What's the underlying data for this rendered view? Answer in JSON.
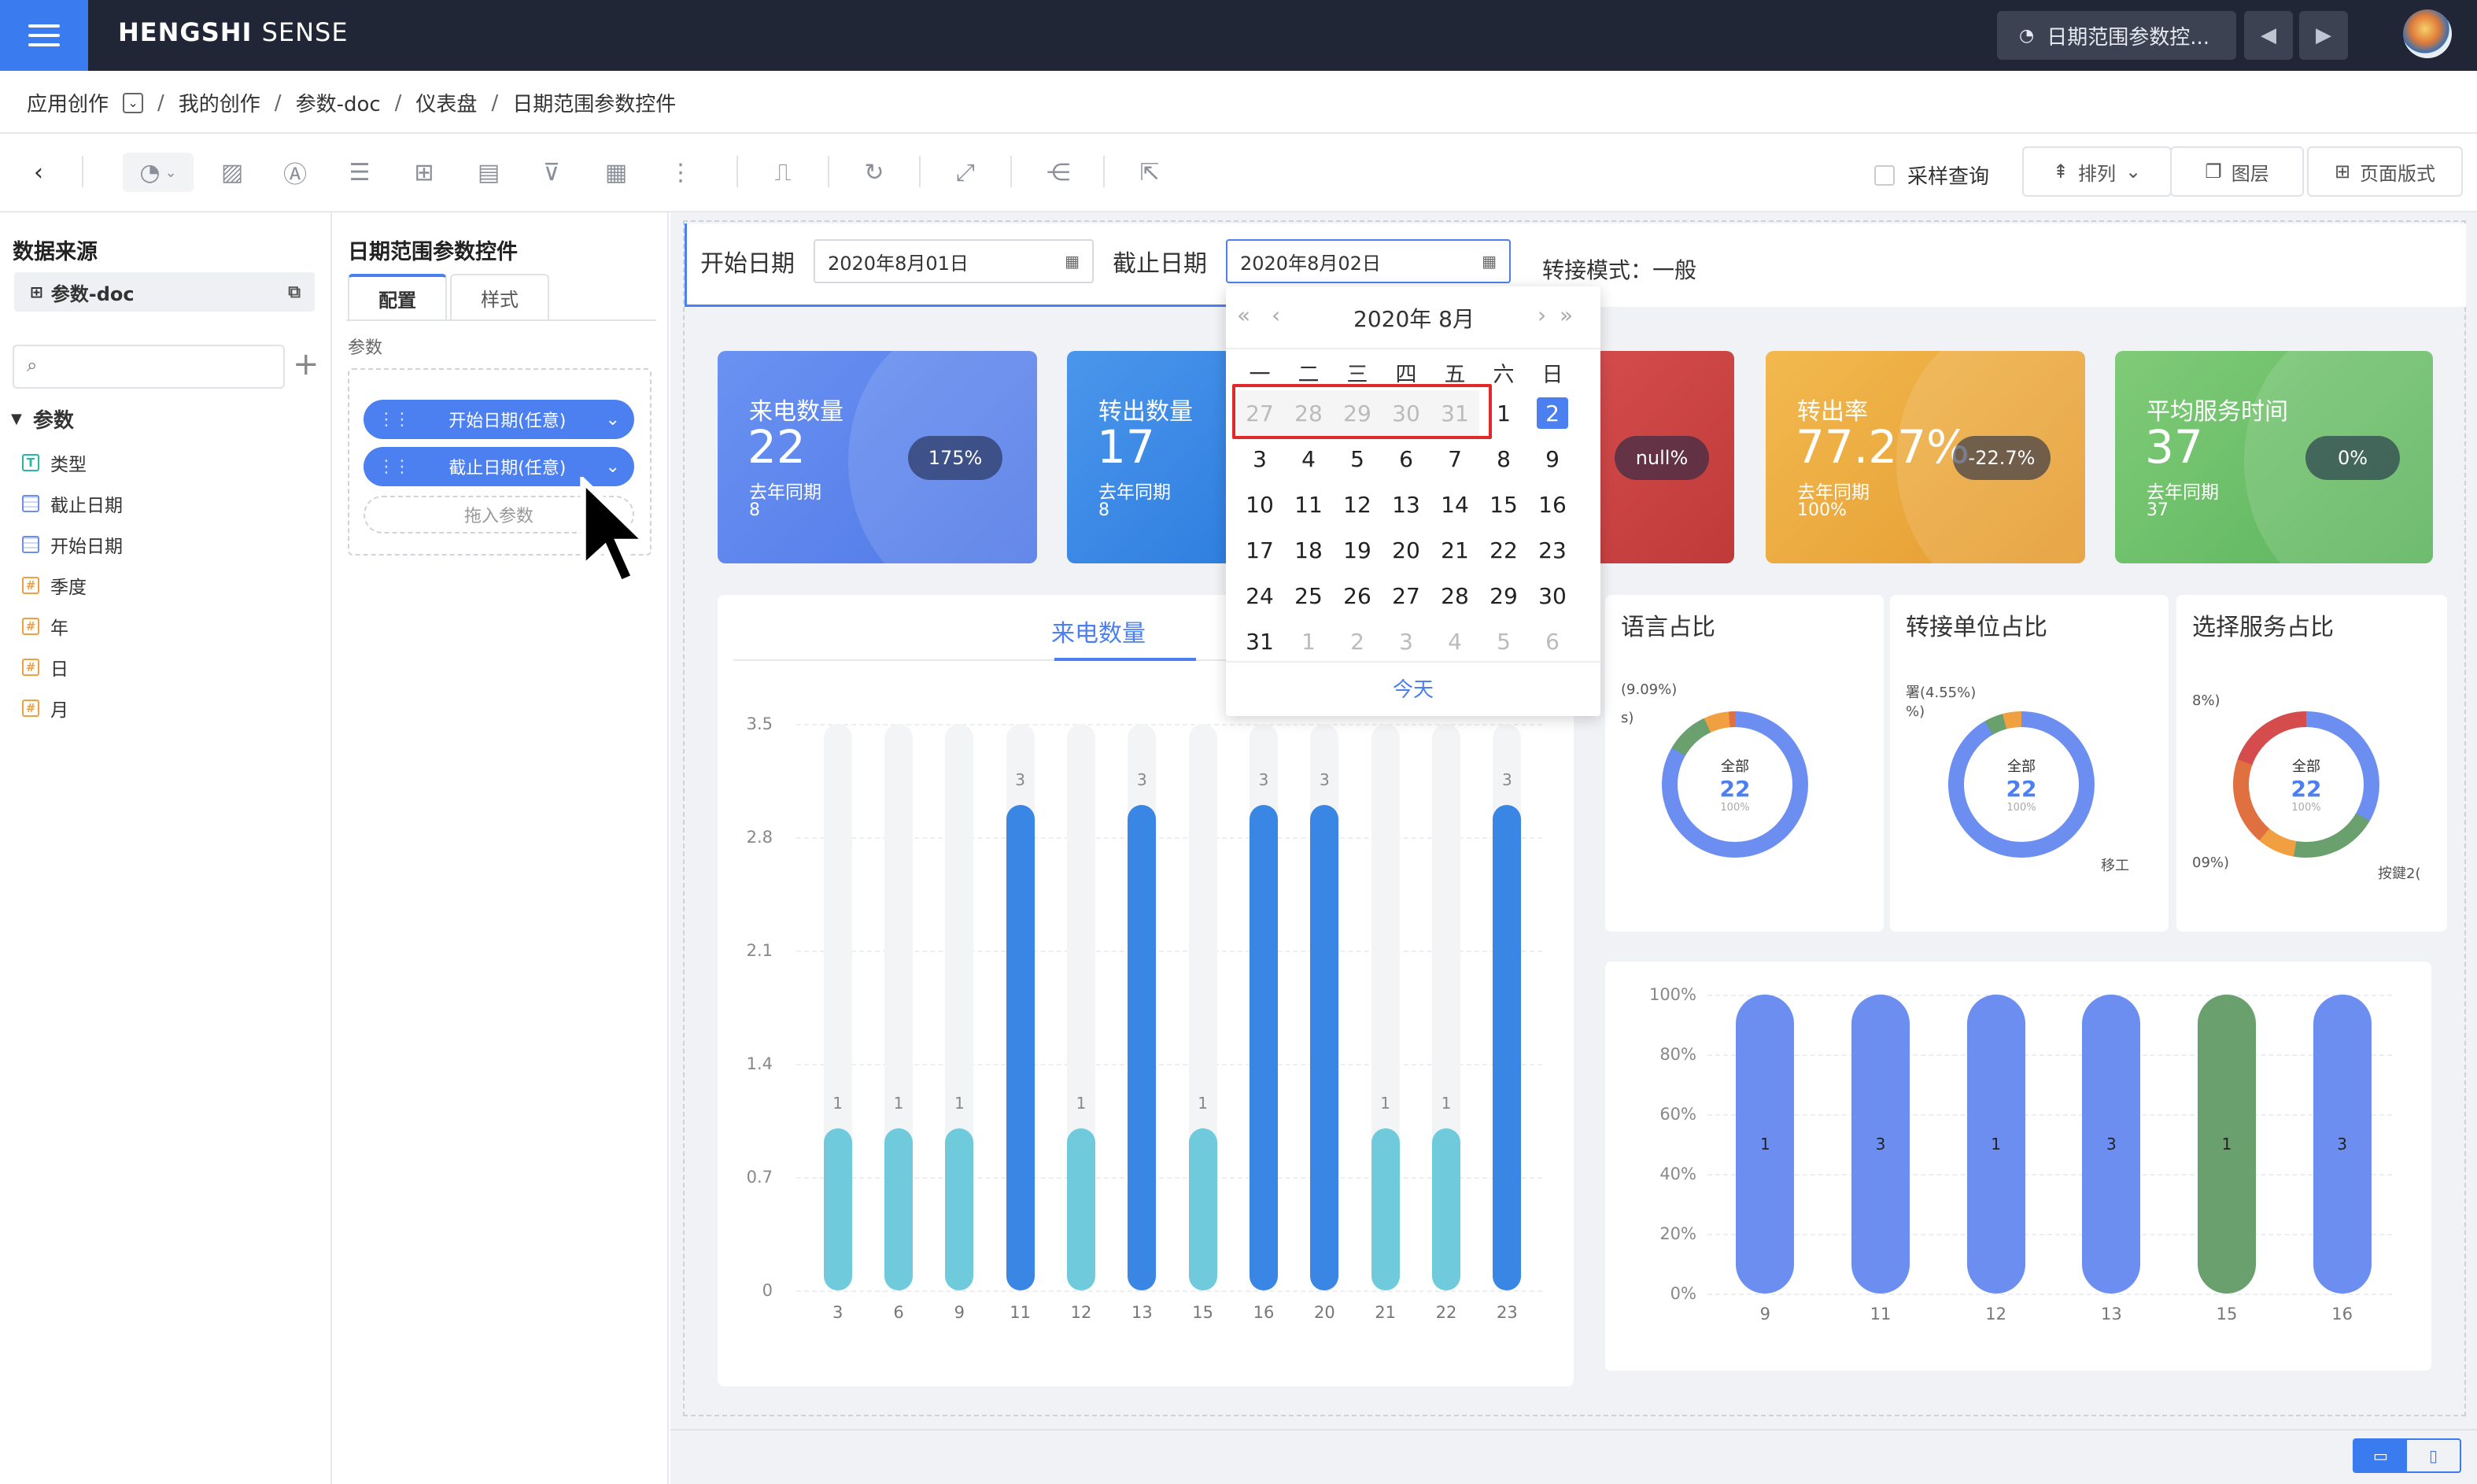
{
  "app": {
    "logo_bold": "HENGSHI",
    "logo_light": "SENSE",
    "current_tab": "日期范围参数控..."
  },
  "breadcrumb": [
    "应用创作",
    "我的创作",
    "参数-doc",
    "仪表盘",
    "日期范围参数控件"
  ],
  "toolbar": {
    "sample_label": "采样查询",
    "arrange_label": "排列",
    "layer_label": "图层",
    "layout_label": "页面版式"
  },
  "left": {
    "datasource_title": "数据来源",
    "datasource_name": "参数-doc",
    "params_title": "参数",
    "fields": [
      {
        "type": "T",
        "name": "类型"
      },
      {
        "type": "date",
        "name": "截止日期"
      },
      {
        "type": "date",
        "name": "开始日期"
      },
      {
        "type": "#",
        "name": "季度"
      },
      {
        "type": "#",
        "name": "年"
      },
      {
        "type": "#",
        "name": "日"
      },
      {
        "type": "#",
        "name": "月"
      }
    ]
  },
  "config": {
    "title": "日期范围参数控件",
    "tab_config": "配置",
    "tab_style": "样式",
    "param_label": "参数",
    "pill1": "开始日期(任意)",
    "pill2": "截止日期(任意)",
    "drop_hint": "拖入参数"
  },
  "filter": {
    "start_label": "开始日期",
    "start_value": "2020年8月01日",
    "end_label": "截止日期",
    "end_value": "2020年8月02日",
    "transfer": "转接模式：一般"
  },
  "kpis": [
    {
      "title": "来电数量",
      "value": "22",
      "sub": "去年同期",
      "prev": "8",
      "badge": "175%",
      "color": "#5b86ee"
    },
    {
      "title": "转出数量",
      "value": "17",
      "sub": "去年同期",
      "prev": "8",
      "badge": "",
      "color": "#3d8ae6"
    },
    {
      "title": "",
      "value": "",
      "sub": "",
      "prev": "",
      "badge": "null%",
      "color": "#d04545"
    },
    {
      "title": "转出率",
      "value": "77.27%",
      "sub": "去年同期",
      "prev": "100%",
      "badge": "-22.7%",
      "color": "#eaa83c"
    },
    {
      "title": "平均服务时间",
      "value": "37",
      "sub": "去年同期",
      "prev": "37",
      "badge": "0%",
      "color": "#6cc06a"
    }
  ],
  "calendar": {
    "header": "2020年 8月",
    "weekdays": [
      "一",
      "二",
      "三",
      "四",
      "五",
      "六",
      "日"
    ],
    "today_label": "今天",
    "days": [
      "27",
      "28",
      "29",
      "30",
      "31",
      "1",
      "2",
      "3",
      "4",
      "5",
      "6",
      "7",
      "8",
      "9",
      "10",
      "11",
      "12",
      "13",
      "14",
      "15",
      "16",
      "17",
      "18",
      "19",
      "20",
      "21",
      "22",
      "23",
      "24",
      "25",
      "26",
      "27",
      "28",
      "29",
      "30",
      "31",
      "1",
      "2",
      "3",
      "4",
      "5",
      "6"
    ],
    "selected_day": "2"
  },
  "bar_chart_tab": "来电数量",
  "donuts": [
    {
      "title": "语言占比",
      "center_top": "全部",
      "center_value": "22",
      "center_pct": "100%",
      "labels": [
        "(9.09%)",
        "s)"
      ]
    },
    {
      "title": "转接单位占比",
      "center_top": "全部",
      "center_value": "22",
      "center_pct": "100%",
      "labels": [
        "署(4.55%)",
        "%)",
        "移工"
      ]
    },
    {
      "title": "选择服务占比",
      "center_top": "全部",
      "center_value": "22",
      "center_pct": "100%",
      "labels": [
        "8%)",
        "09%)",
        "按鍵2("
      ]
    }
  ],
  "chart_data": [
    {
      "type": "bar",
      "categories": [
        "3",
        "6",
        "9",
        "11",
        "12",
        "13",
        "15",
        "16",
        "20",
        "21",
        "22",
        "23"
      ],
      "values": [
        1,
        1,
        1,
        3,
        1,
        3,
        1,
        3,
        3,
        1,
        1,
        3
      ],
      "ylim": [
        0,
        3.5
      ],
      "yticks": [
        "0",
        "0.7",
        "1.4",
        "2.1",
        "2.8",
        "3.5"
      ],
      "colors": {
        "low": "#6fcbdc",
        "high": "#3a86e4"
      }
    },
    {
      "type": "bar",
      "categories": [
        "9",
        "11",
        "12",
        "13",
        "15",
        "16"
      ],
      "values": [
        1,
        3,
        1,
        3,
        1,
        3
      ],
      "yticks": [
        "0%",
        "20%",
        "40%",
        "60%",
        "80%",
        "100%"
      ],
      "colors": [
        "#6b8ef0",
        "#6b8ef0",
        "#6b8ef0",
        "#6b8ef0",
        "#6aa06e",
        "#6b8ef0"
      ]
    }
  ]
}
